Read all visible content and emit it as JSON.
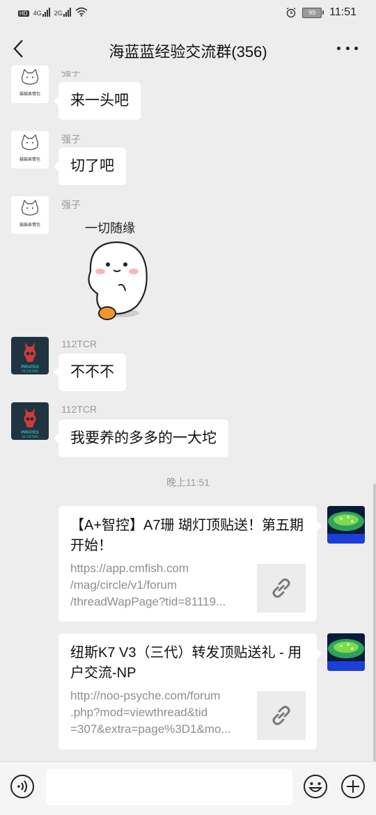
{
  "status_bar": {
    "left_indicators": [
      "HD",
      "4G",
      "2G"
    ],
    "battery": "99",
    "time": "11:51"
  },
  "header": {
    "title": "海蓝蓝经验交流群(356)",
    "back_icon": "chevron-left-icon",
    "more_icon": "more-dots-icon"
  },
  "messages": [
    {
      "sender": "强子",
      "text": "来一头吧"
    },
    {
      "sender": "强子",
      "text": "切了吧"
    },
    {
      "sender": "强子",
      "sticker_text": "一切随缘"
    },
    {
      "sender": "112TCR",
      "text": "不不不"
    },
    {
      "sender": "112TCR",
      "text": "我要养的多多的一大坨"
    }
  ],
  "avatar_labels": {
    "cat": "猫猫表情包",
    "skull_line1": "PIRATES",
    "skull_line2": "GLOSTAN"
  },
  "timestamp": "晚上11:51",
  "link_cards": [
    {
      "title": "【A+智控】A7珊 瑚灯顶贴送！第五期开始！",
      "url_lines": [
        "https://app.cmfish.com",
        "/mag/circle/v1/forum",
        "/threadWapPage?tid=81119..."
      ],
      "icon": "link-icon"
    },
    {
      "title": "纽斯K7 V3（三代）转发顶贴送礼 - 用户交流-NP",
      "url_lines": [
        "http://noo-psyche.com/forum",
        ".php?mod=viewthread&tid",
        "=307&extra=page%3D1&mo..."
      ],
      "icon": "link-icon"
    }
  ],
  "input_bar": {
    "placeholder": "",
    "voice_icon": "voice-icon",
    "emoji_icon": "emoji-icon",
    "plus_icon": "plus-icon"
  },
  "colors": {
    "background": "#ededed",
    "bubble": "#ffffff",
    "meta_text": "#9a9a9a"
  }
}
